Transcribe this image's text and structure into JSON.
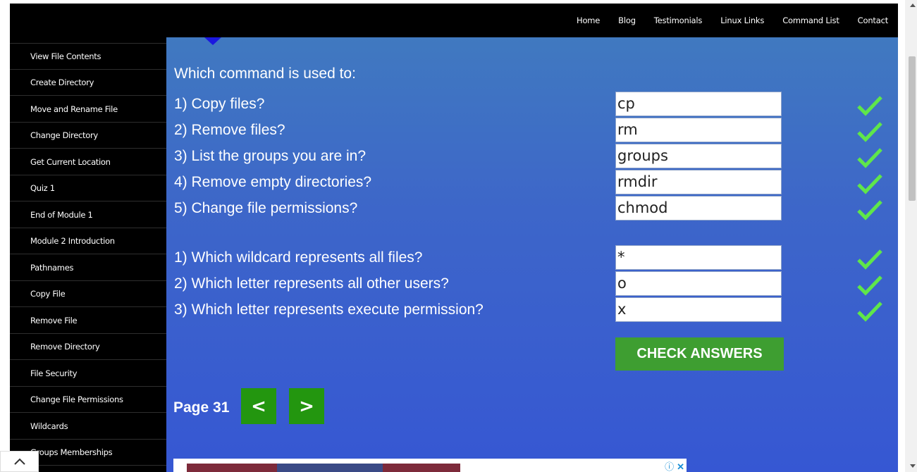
{
  "topnav": [
    "Home",
    "Blog",
    "Testimonials",
    "Linux Links",
    "Command List",
    "Contact"
  ],
  "sidebar": [
    "View File Contents",
    "Create Directory",
    "Move and Rename File",
    "Change Directory",
    "Get Current Location",
    "Quiz 1",
    "End of Module 1",
    "Module 2 Introduction",
    "Pathnames",
    "Copy File",
    "Remove File",
    "Remove Directory",
    "File Security",
    "Change File Permissions",
    "Wildcards",
    "Groups Memberships"
  ],
  "quiz": {
    "heading": "Which command is used to:",
    "questions": [
      {
        "label": "1) Copy files?",
        "answer": "cp",
        "correct": true
      },
      {
        "label": "2) Remove files?",
        "answer": "rm",
        "correct": true
      },
      {
        "label": "3) List the groups you are in?",
        "answer": "groups",
        "correct": true
      },
      {
        "label": "4) Remove empty directories?",
        "answer": "rmdir",
        "correct": true
      },
      {
        "label": "5) Change file permissions?",
        "answer": "chmod",
        "correct": true
      },
      {
        "label": "1) Which wildcard represents all files?",
        "answer": "*",
        "correct": true
      },
      {
        "label": "2) Which letter represents all other users?",
        "answer": "o",
        "correct": true
      },
      {
        "label": "3) Which letter represents execute permission?",
        "answer": "x",
        "correct": true
      }
    ],
    "check_button": "CHECK ANSWERS"
  },
  "pager": {
    "label": "Page 31",
    "prev": "<",
    "next": ">"
  },
  "ad": {
    "info": "ⓘ",
    "close": "✕"
  },
  "icons": {
    "check": "checkmark-icon",
    "back_to_top": "chevron-up-icon"
  },
  "colors": {
    "check": "#5fe64a",
    "button": "#3e9e31",
    "nav": "#23960f"
  }
}
